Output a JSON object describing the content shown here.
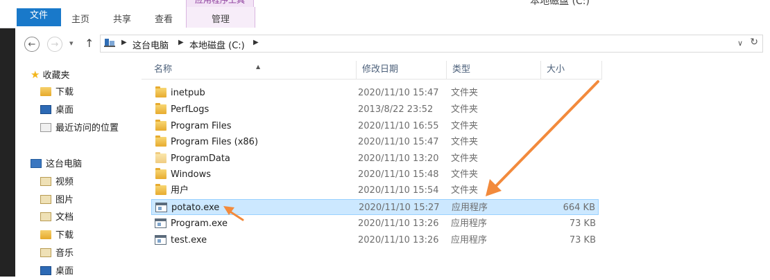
{
  "window": {
    "title": "本地磁盘 (C:)",
    "context_group": "应用程序工具"
  },
  "ribbon": {
    "tabs": [
      {
        "label": "文件"
      },
      {
        "label": "主页"
      },
      {
        "label": "共享"
      },
      {
        "label": "查看"
      },
      {
        "label": "管理"
      }
    ]
  },
  "address": {
    "crumbs": [
      "这台电脑",
      "本地磁盘 (C:)"
    ],
    "separator": "▶"
  },
  "nav": {
    "favorites_label": "收藏夹",
    "favorites": [
      "下载",
      "桌面",
      "最近访问的位置"
    ],
    "pc_label": "这台电脑",
    "pc_items": [
      "视频",
      "图片",
      "文档",
      "下载",
      "音乐",
      "桌面"
    ]
  },
  "columns": {
    "name": "名称",
    "date": "修改日期",
    "type": "类型",
    "size": "大小"
  },
  "files": [
    {
      "name": "inetpub",
      "date": "2020/11/10 15:47",
      "type": "文件夹",
      "size": "",
      "kind": "folder"
    },
    {
      "name": "PerfLogs",
      "date": "2013/8/22 23:52",
      "type": "文件夹",
      "size": "",
      "kind": "folder"
    },
    {
      "name": "Program Files",
      "date": "2020/11/10 16:55",
      "type": "文件夹",
      "size": "",
      "kind": "folder"
    },
    {
      "name": "Program Files (x86)",
      "date": "2020/11/10 15:47",
      "type": "文件夹",
      "size": "",
      "kind": "folder"
    },
    {
      "name": "ProgramData",
      "date": "2020/11/10 13:20",
      "type": "文件夹",
      "size": "",
      "kind": "folder"
    },
    {
      "name": "Windows",
      "date": "2020/11/10 15:48",
      "type": "文件夹",
      "size": "",
      "kind": "folder"
    },
    {
      "name": "用户",
      "date": "2020/11/10 15:54",
      "type": "文件夹",
      "size": "",
      "kind": "folder"
    },
    {
      "name": "potato.exe",
      "date": "2020/11/10 15:27",
      "type": "应用程序",
      "size": "664 KB",
      "kind": "exe",
      "selected": true
    },
    {
      "name": "Program.exe",
      "date": "2020/11/10 13:26",
      "type": "应用程序",
      "size": "73 KB",
      "kind": "exe"
    },
    {
      "name": "test.exe",
      "date": "2020/11/10 13:26",
      "type": "应用程序",
      "size": "73 KB",
      "kind": "exe"
    }
  ],
  "colors": {
    "accent": "#1979ca",
    "selection": "#cce8ff",
    "annotation": "#f28a3c"
  }
}
